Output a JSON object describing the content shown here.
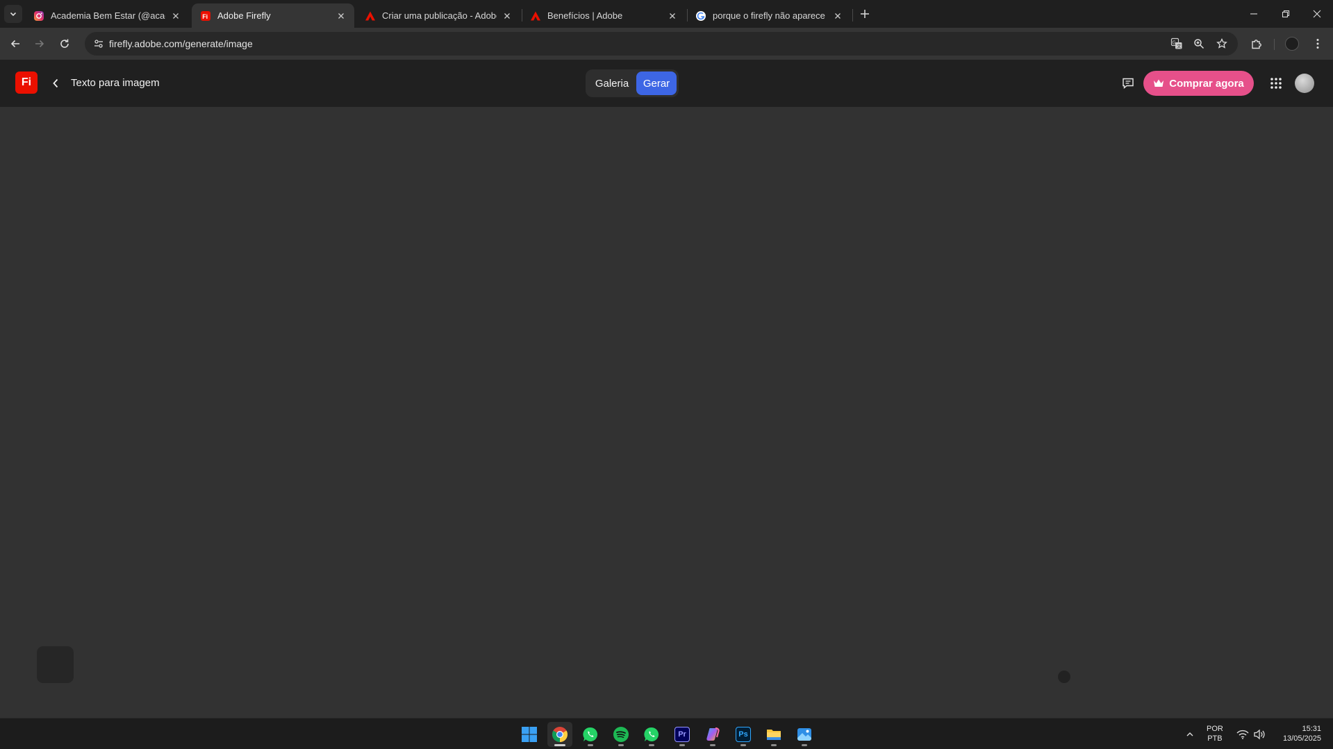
{
  "browser": {
    "tabs": [
      {
        "title": "Academia Bem Estar (@acade_l",
        "favicon": "instagram-icon",
        "active": false
      },
      {
        "title": "Adobe Firefly",
        "favicon": "firefly-icon",
        "active": true
      },
      {
        "title": "Criar uma publicação - Adobe C",
        "favicon": "adobe-icon",
        "active": false
      },
      {
        "title": "Benefícios | Adobe",
        "favicon": "adobe-icon",
        "active": false
      },
      {
        "title": "porque o firefly não aparece - F",
        "favicon": "google-icon",
        "active": false
      }
    ],
    "url": "firefly.adobe.com/generate/image"
  },
  "app": {
    "logo_text": "Fi",
    "page_title": "Texto para imagem",
    "segments": {
      "galeria": "Galeria",
      "gerar": "Gerar"
    },
    "buy_label": "Comprar agora"
  },
  "taskbar": {
    "apps": [
      "windows-start-icon",
      "chrome-icon",
      "whatsapp-icon",
      "spotify-icon",
      "whatsapp-icon",
      "premiere-pro-icon",
      "copilot-icon",
      "photoshop-icon",
      "file-explorer-icon",
      "photos-icon"
    ],
    "premiere_label": "Pr",
    "photoshop_label": "Ps",
    "lang_line1": "POR",
    "lang_line2": "PTB",
    "time": "15:31",
    "date": "13/05/2025"
  },
  "colors": {
    "accent_blue": "#3d66e5",
    "buy_pink": "#e6508a",
    "firefly_red": "#eb1000"
  }
}
